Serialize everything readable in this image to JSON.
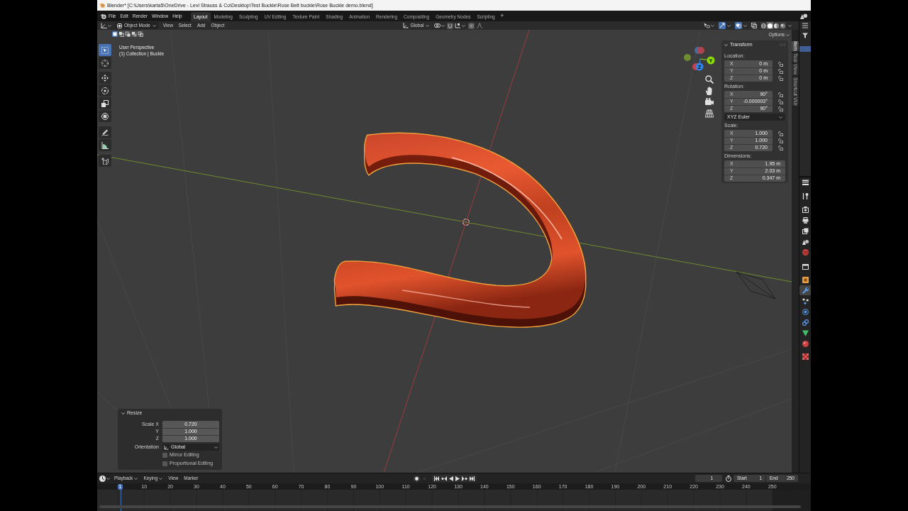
{
  "title_bar": {
    "title": "Blender* [C:\\Users\\karta5\\OneDrive - Levi Strauss & Co\\Desktop\\Test Buckle\\Rose Belt buckle\\Rose Buckle demo.blend]"
  },
  "menu_bar": {
    "menus": [
      "File",
      "Edit",
      "Render",
      "Window",
      "Help"
    ],
    "workspaces": [
      {
        "label": "Layout",
        "selected": true
      },
      {
        "label": "Modeling",
        "selected": false
      },
      {
        "label": "Sculpting",
        "selected": false
      },
      {
        "label": "UV Editing",
        "selected": false
      },
      {
        "label": "Texture Paint",
        "selected": false
      },
      {
        "label": "Shading",
        "selected": false
      },
      {
        "label": "Animation",
        "selected": false
      },
      {
        "label": "Rendering",
        "selected": false
      },
      {
        "label": "Compositing",
        "selected": false
      },
      {
        "label": "Geometry Nodes",
        "selected": false
      },
      {
        "label": "Scripting",
        "selected": false
      }
    ],
    "add_workspace": "+"
  },
  "viewport_header": {
    "mode": "Object Mode",
    "menus": [
      "View",
      "Select",
      "Add",
      "Object"
    ],
    "orientation": "Global",
    "gizmos_on": true,
    "overlays_on": true,
    "xray_on": false,
    "shading_modes": [
      {
        "kind": "wireframe",
        "selected": false
      },
      {
        "kind": "solid",
        "selected": true
      },
      {
        "kind": "material",
        "selected": false
      },
      {
        "kind": "rendered",
        "selected": false
      }
    ]
  },
  "tool_header": {
    "select_modes": [
      {
        "kind": "set",
        "selected": true
      },
      {
        "kind": "extend",
        "selected": false
      },
      {
        "kind": "subtract",
        "selected": false
      },
      {
        "kind": "invert",
        "selected": false
      },
      {
        "kind": "intersect",
        "selected": false
      }
    ],
    "options": "Options"
  },
  "toolbar": [
    {
      "kind": "select_box",
      "selected": true
    },
    {
      "kind": "cursor",
      "selected": false
    },
    {
      "kind": "move",
      "selected": false
    },
    {
      "kind": "rotate",
      "selected": false
    },
    {
      "kind": "scale",
      "selected": false
    },
    {
      "kind": "transform",
      "selected": false
    },
    {
      "kind": "annotate",
      "selected": false
    },
    {
      "kind": "measure",
      "selected": false
    },
    {
      "kind": "add_cube",
      "selected": false
    }
  ],
  "viewport": {
    "view_name": "User Perspective",
    "collection": "(1) Collection | Buckle",
    "object_selected": true
  },
  "navigation_gizmo": {
    "axes": [
      {
        "kind": "negative",
        "color": "#4a6a9a"
      },
      {
        "kind": "negative",
        "color": "#b2444f"
      },
      {
        "kind": "negative",
        "color": "#6e8c30"
      },
      {
        "kind": "positive",
        "color": "#8bdc00",
        "label": "Y"
      },
      {
        "kind": "negative",
        "color": "#c8404c"
      },
      {
        "kind": "positive",
        "color": "#2f83e3",
        "label": "Z"
      }
    ]
  },
  "sidebar": {
    "tabs": [
      {
        "label": "Item",
        "selected": true
      },
      {
        "label": "Tool",
        "selected": false
      },
      {
        "label": "View",
        "selected": false
      },
      {
        "label": "Shortcut VUr",
        "selected": false
      }
    ],
    "panel": {
      "title": "Transform",
      "expanded": true,
      "groups": [
        {
          "label": "Location:",
          "fields": [
            {
              "axis": "X",
              "value": "0 m",
              "locked": false
            },
            {
              "axis": "Y",
              "value": "0 m",
              "locked": false
            },
            {
              "axis": "Z",
              "value": "0 m",
              "locked": false
            }
          ]
        },
        {
          "label": "Rotation:",
          "fields": [
            {
              "axis": "X",
              "value": "90°",
              "locked": false
            },
            {
              "axis": "Y",
              "value": "-0.000003°",
              "locked": false
            },
            {
              "axis": "Z",
              "value": "90°",
              "locked": false
            }
          ],
          "mode": "XYZ Euler"
        },
        {
          "label": "Scale:",
          "fields": [
            {
              "axis": "X",
              "value": "1.000",
              "locked": false
            },
            {
              "axis": "Y",
              "value": "1.000",
              "locked": false
            },
            {
              "axis": "Z",
              "value": "0.720",
              "locked": false
            }
          ]
        },
        {
          "label": "Dimensions:",
          "fields": [
            {
              "axis": "X",
              "value": "1.95 m"
            },
            {
              "axis": "Y",
              "value": "2.03 m"
            },
            {
              "axis": "Z",
              "value": "0.347 m"
            }
          ]
        }
      ]
    }
  },
  "operator_panel": {
    "title": "Resize",
    "expanded": true,
    "fields": [
      {
        "label": "Scale X",
        "value": "0.720"
      },
      {
        "label": "Y",
        "value": "1.000"
      },
      {
        "label": "Z",
        "value": "1.000"
      }
    ],
    "orientation": {
      "label": "Orientation",
      "value": "Global"
    },
    "options": [
      {
        "label": "Mirror Editing",
        "checked": false
      },
      {
        "label": "Proportional Editing",
        "checked": false
      }
    ]
  },
  "outliner": {
    "rows": [
      {
        "selected": true
      }
    ]
  },
  "properties_tabs": [
    {
      "kind": "tool",
      "selected": false
    },
    {
      "kind": "render",
      "selected": false
    },
    {
      "kind": "output",
      "selected": false
    },
    {
      "kind": "view_layer",
      "selected": false
    },
    {
      "kind": "scene",
      "selected": false
    },
    {
      "kind": "world",
      "selected": false
    },
    {
      "kind": "collection",
      "selected": false
    },
    {
      "kind": "object",
      "selected": false
    },
    {
      "kind": "modifiers",
      "selected": true
    },
    {
      "kind": "particles",
      "selected": false
    },
    {
      "kind": "physics",
      "selected": false
    },
    {
      "kind": "constraints",
      "selected": false
    },
    {
      "kind": "data",
      "selected": false
    },
    {
      "kind": "material",
      "selected": false
    },
    {
      "kind": "texture",
      "selected": false
    }
  ],
  "timeline": {
    "menus": [
      {
        "label": "Playback",
        "dropdown": true
      },
      {
        "label": "Keying",
        "dropdown": true
      },
      {
        "label": "View",
        "dropdown": false
      },
      {
        "label": "Marker",
        "dropdown": false
      }
    ],
    "current_frame": "1",
    "start": {
      "label": "Start",
      "value": "1"
    },
    "end": {
      "label": "End",
      "value": "250"
    },
    "playhead": "1",
    "ruler": [
      "10",
      "20",
      "30",
      "40",
      "50",
      "60",
      "70",
      "80",
      "90",
      "100",
      "110",
      "120",
      "130",
      "140",
      "150",
      "160",
      "170",
      "180",
      "190",
      "200",
      "210",
      "220",
      "230",
      "240",
      "250"
    ]
  }
}
